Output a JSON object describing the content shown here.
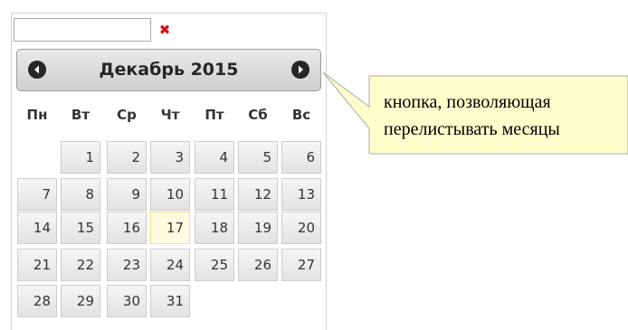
{
  "datepicker": {
    "input": {
      "value": "",
      "placeholder": ""
    },
    "clear_icon": "close-icon",
    "clear_color": "#cc1111",
    "header": {
      "title": "Декабрь 2015",
      "prev_icon": "chevron-left-circle-icon",
      "next_icon": "chevron-right-circle-icon"
    },
    "weekdays": [
      "Пн",
      "Вт",
      "Ср",
      "Чт",
      "Пт",
      "Сб",
      "Вс"
    ],
    "first_weekday_offset": 1,
    "days": [
      "1",
      "2",
      "3",
      "4",
      "5",
      "6",
      "7",
      "8",
      "9",
      "10",
      "11",
      "12",
      "13",
      "14",
      "15",
      "16",
      "17",
      "18",
      "19",
      "20",
      "21",
      "22",
      "23",
      "24",
      "25",
      "26",
      "27",
      "28",
      "29",
      "30",
      "31"
    ],
    "today": "17",
    "today_color": "#fffbe0"
  },
  "callout": {
    "lines": [
      "кнопка, позволяющая",
      "перелистывать месяцы"
    ],
    "fill": "#ffffcc",
    "border": "#a9a9a9"
  }
}
